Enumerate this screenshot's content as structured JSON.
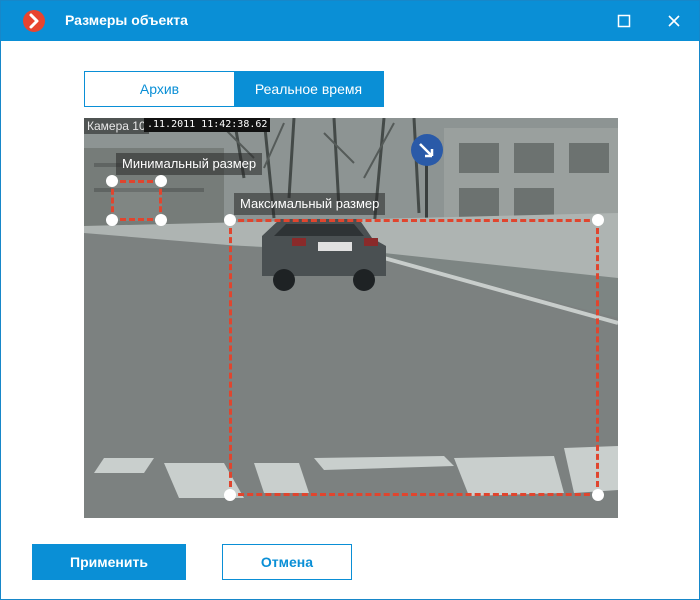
{
  "window": {
    "title": "Размеры объекта",
    "logo_icon": "app-logo-icon",
    "maximize_icon": "maximize-icon",
    "close_icon": "close-icon",
    "titlebar_color": "#0a8fd6"
  },
  "tabs": [
    {
      "label": "Архив",
      "active": false
    },
    {
      "label": "Реальное время",
      "active": true
    }
  ],
  "video": {
    "camera_label": "Камера 10",
    "timestamp": ".11.2011 11:42:38.62",
    "zones": {
      "min_label": "Минимальный размер",
      "max_label": "Максимальный размер",
      "border_color": "#e0452e"
    }
  },
  "buttons": {
    "apply": "Применить",
    "cancel": "Отмена"
  }
}
